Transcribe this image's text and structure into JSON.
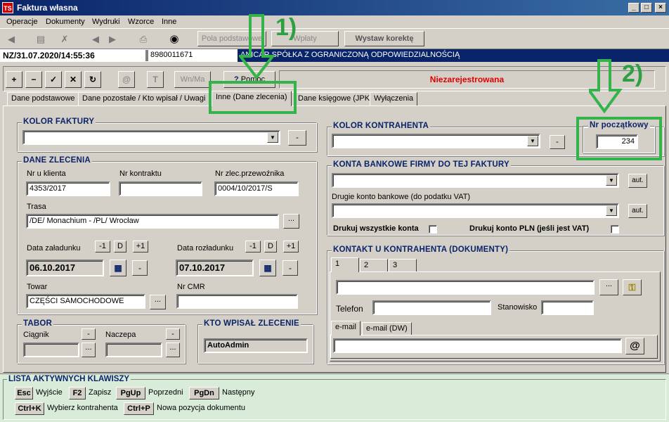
{
  "window": {
    "icon": "TS",
    "title": "Faktura własna",
    "min": "_",
    "max": "□",
    "close": "×"
  },
  "menu": [
    "Operacje",
    "Dokumenty",
    "Wydruki",
    "Wzorce",
    "Inne"
  ],
  "toolbar": {
    "pola": "Pola podstawowe",
    "wplaty": "Wpłaty",
    "wystaw": "Wystaw korektę"
  },
  "status": {
    "doc": "NZ/31.07.2020/14:55:36",
    "nip": "8980011671",
    "company": "ANICAR SPÓŁKA Z OGRANICZONĄ ODPOWIEDZIALNOŚCIĄ"
  },
  "actions": {
    "plus": "+",
    "minus": "−",
    "ok": "✓",
    "cancel": "✕",
    "refresh": "↻",
    "at": "@",
    "t": "T",
    "wnma": "Wn/Ma",
    "pomoc": "Pomoc",
    "pomoc_icon": "?",
    "state": "Niezarejestrowana"
  },
  "tabs": [
    "Dane podstawowe",
    "Dane pozostałe / Kto wpisał / Uwagi",
    "Inne (Dane zlecenia)",
    "Dane księgowe (JPK)",
    "Wyłączenia"
  ],
  "kolor_faktury": {
    "label": "KOLOR FAKTURY",
    "value": "",
    "btn": "-"
  },
  "dane_zlecenia": {
    "label": "DANE ZLECENIA",
    "nr_klienta_label": "Nr u klienta",
    "nr_klienta": "4353/2017",
    "nr_kontraktu_label": "Nr kontraktu",
    "nr_kontraktu": "",
    "nr_zlec_label": "Nr zlec.przewoźnika",
    "nr_zlec": "0004/10/2017/S",
    "trasa_label": "Trasa",
    "trasa": "/DE/ Monachium - /PL/ Wrocław",
    "data_zal_label": "Data załadunku",
    "data_zal": "06.10.2017",
    "data_roz_label": "Data rozładunku",
    "data_roz": "07.10.2017",
    "towar_label": "Towar",
    "towar": "CZĘŚCI SAMOCHODOWE",
    "cmr_label": "Nr CMR",
    "cmr": "",
    "m1": "-1",
    "d": "D",
    "p1": "+1",
    "dots": "...",
    "minus": "-"
  },
  "tabor": {
    "label": "TABOR",
    "ciagnik": "Ciągnik",
    "naczepa": "Naczepa"
  },
  "kto": {
    "label": "KTO WPISAŁ ZLECENIE",
    "value": "AutoAdmin"
  },
  "kolor_kontrahenta": {
    "label": "KOLOR KONTRAHENTA",
    "btn": "-"
  },
  "nr_pocz": {
    "label": "Nr początkowy",
    "value": "234"
  },
  "konta": {
    "label": "KONTA BANKOWE FIRMY DO TEJ FAKTURY",
    "aut": "aut.",
    "drugie": "Drugie konto bankowe (do podatku VAT)",
    "drukuj_all": "Drukuj wszystkie konta",
    "drukuj_pln": "Drukuj konto PLN (jeśli jest VAT)"
  },
  "kontakt": {
    "label": "KONTAKT U KONTRAHENTA (DOKUMENTY)",
    "tabs": [
      "1",
      "2",
      "3"
    ],
    "telefon": "Telefon",
    "stanowisko": "Stanowisko",
    "email_tabs": [
      "e-mail",
      "e-mail (DW)"
    ],
    "at": "@"
  },
  "keys": {
    "label": "LISTA AKTYWNYCH KLAWISZY",
    "items": [
      {
        "k": "Esc",
        "d": "Wyjście"
      },
      {
        "k": "F2",
        "d": "Zapisz"
      },
      {
        "k": "PgUp",
        "d": "Poprzedni"
      },
      {
        "k": "PgDn",
        "d": "Następny"
      },
      {
        "k": "Ctrl+K",
        "d": "Wybierz kontrahenta"
      },
      {
        "k": "Ctrl+P",
        "d": "Nowa pozycja dokumentu"
      }
    ]
  },
  "annotations": {
    "one": "1)",
    "two": "2)"
  },
  "colors": {
    "title": "#0a246a",
    "annot": "#33b34a",
    "state": "#e00000",
    "keys_bg": "#d9ecd9"
  }
}
